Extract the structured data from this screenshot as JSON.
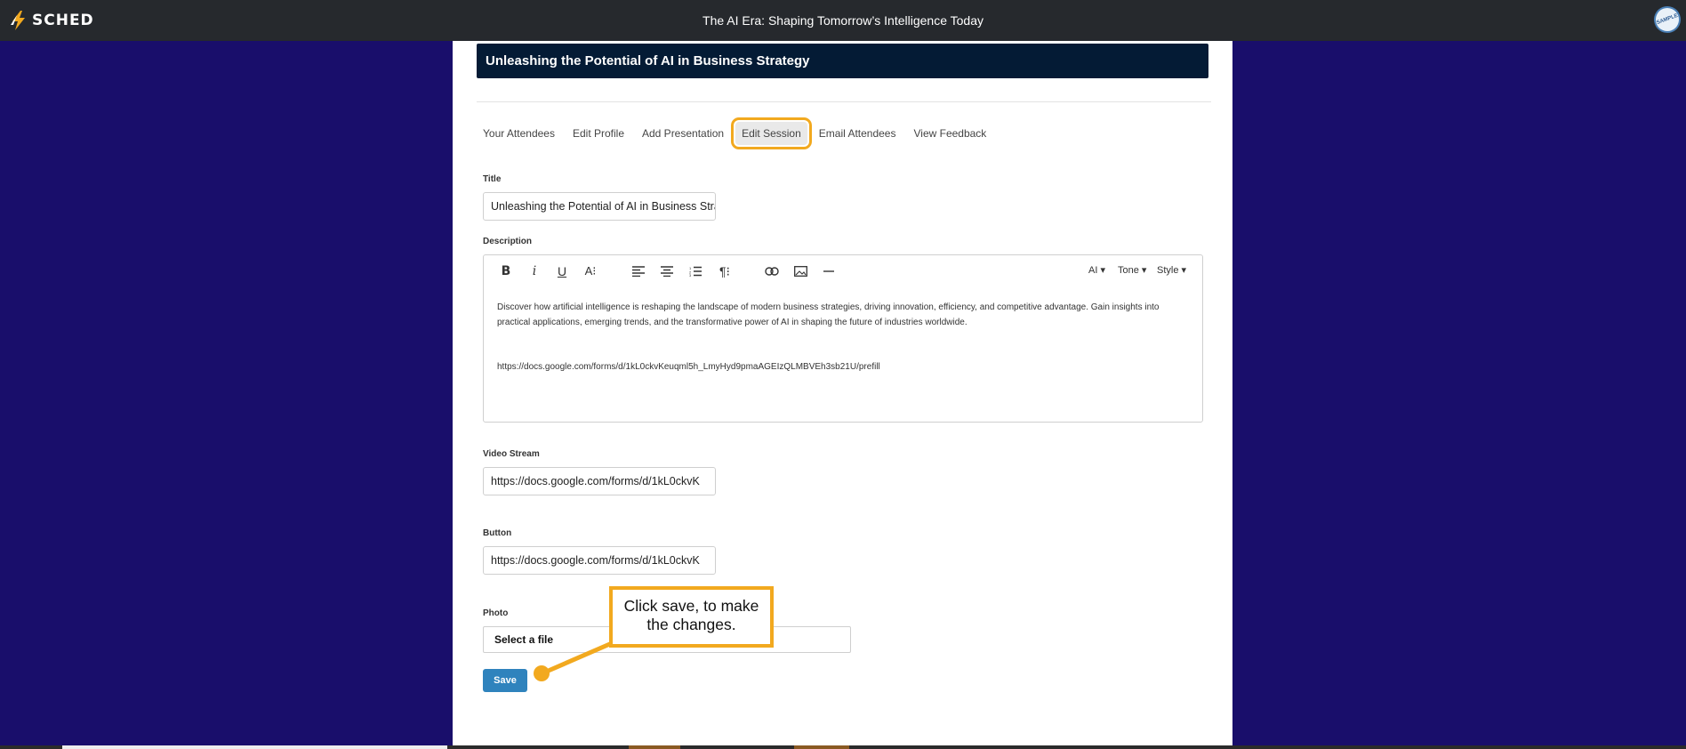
{
  "app": {
    "logo_text": "SCHED",
    "event_title": "The AI Era: Shaping Tomorrow’s Intelligence Today",
    "badge_text": "SAMPLE"
  },
  "session": {
    "header_title": "Unleashing the Potential of AI in Business Strategy"
  },
  "tabs": [
    {
      "label": "Your Attendees"
    },
    {
      "label": "Edit Profile"
    },
    {
      "label": "Add Presentation"
    },
    {
      "label": "Edit Session",
      "active": true
    },
    {
      "label": "Email Attendees"
    },
    {
      "label": "View Feedback"
    }
  ],
  "form": {
    "title_label": "Title",
    "title_value": "Unleashing the Potential of AI in Business Strategy",
    "description_label": "Description",
    "toolbar": {
      "ai_label": "AI",
      "tone_label": "Tone",
      "style_label": "Style"
    },
    "description_text": "Discover how artificial intelligence is reshaping the landscape of modern business strategies, driving innovation, efficiency, and competitive advantage. Gain insights into practical applications, emerging trends, and the transformative power of AI in shaping the future of industries worldwide.",
    "description_link": "https://docs.google.com/forms/d/1kL0ckvKeuqml5h_LmyHyd9pmaAGEIzQLMBVEh3sb21U/prefill",
    "video_label": "Video Stream",
    "video_value": "https://docs.google.com/forms/d/1kL0ckvK",
    "button_label": "Button",
    "button_value": "https://docs.google.com/forms/d/1kL0ckvK",
    "photo_label": "Photo",
    "file_label": "Select a file",
    "save_label": "Save"
  },
  "callout": {
    "text": "Click save, to make the changes."
  },
  "colors": {
    "background": "#190e6b",
    "topbar": "#26292d",
    "header": "#041b35",
    "highlight": "#f2a91f",
    "save_button": "#2f83bd"
  }
}
